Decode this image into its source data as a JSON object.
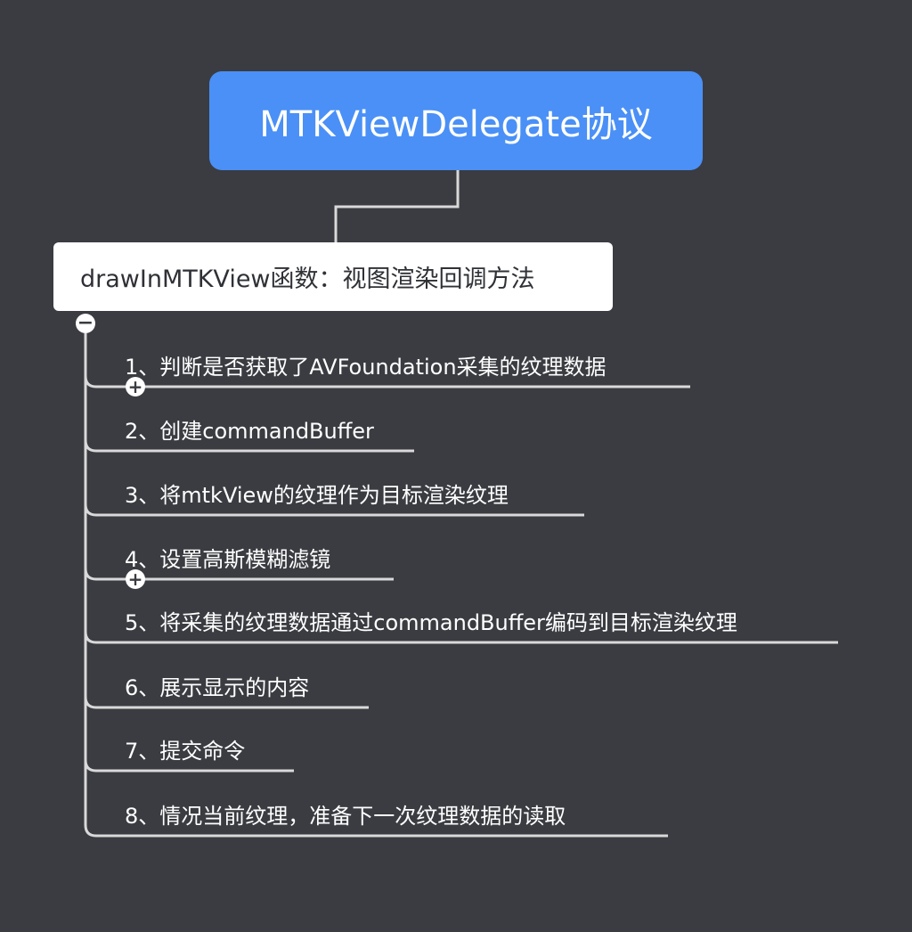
{
  "root": {
    "label": "MTKViewDelegate协议"
  },
  "main": {
    "label": "drawInMTKView函数：视图渲染回调方法"
  },
  "items": [
    {
      "label": "1、判断是否获取了AVFoundation采集的纹理数据",
      "collapsed": true
    },
    {
      "label": "2、创建commandBuffer",
      "collapsed": false
    },
    {
      "label": "3、将mtkView的纹理作为目标渲染纹理",
      "collapsed": false
    },
    {
      "label": "4、设置高斯模糊滤镜",
      "collapsed": true
    },
    {
      "label": "5、将采集的纹理数据通过commandBuffer编码到目标渲染纹理",
      "collapsed": false
    },
    {
      "label": "6、展示显示的内容",
      "collapsed": false
    },
    {
      "label": "7、提交命令",
      "collapsed": false
    },
    {
      "label": "8、情况当前纹理，准备下一次纹理数据的读取",
      "collapsed": false
    }
  ],
  "colors": {
    "background": "#3a3c41",
    "root": "#4a90f6",
    "line": "#d9d9d9"
  },
  "icons": {
    "collapse": "minus-circle-icon",
    "expand": "plus-circle-icon"
  }
}
